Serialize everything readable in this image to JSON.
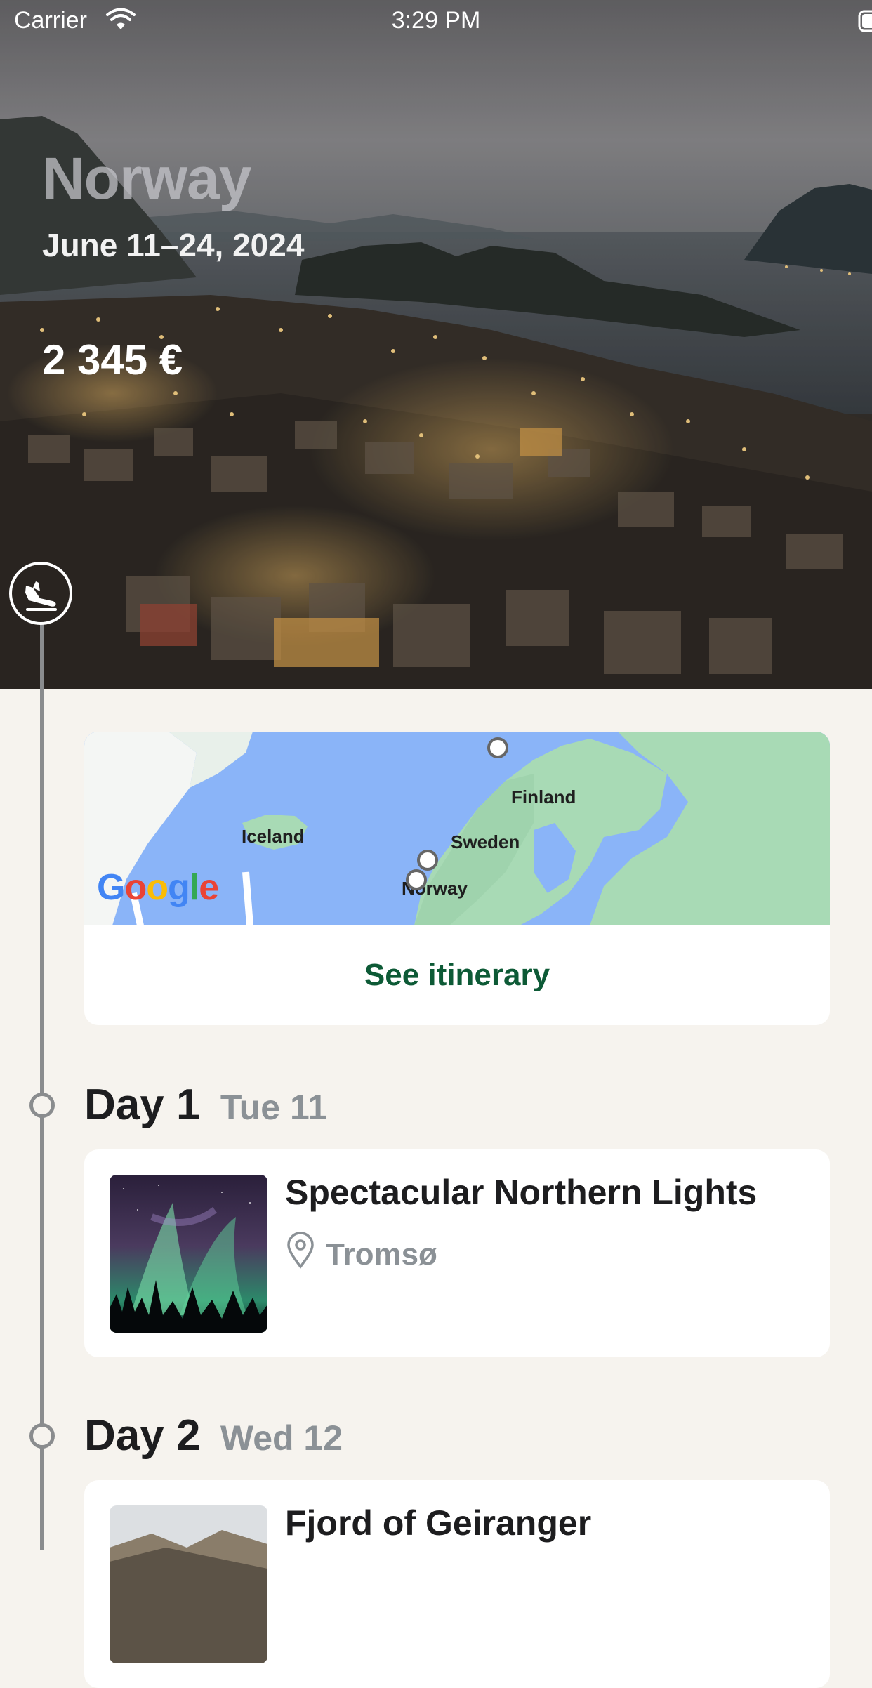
{
  "status_bar": {
    "carrier": "Carrier",
    "time": "3:29 PM"
  },
  "trip": {
    "destination": "Norway",
    "dates": "June 11–24, 2024",
    "price": "2 345 €"
  },
  "map": {
    "labels": [
      "Finland",
      "Iceland",
      "Sweden",
      "Norway"
    ],
    "logo": "Google",
    "see_itinerary_label": "See itinerary"
  },
  "days": [
    {
      "title": "Day 1",
      "date": "Tue 11",
      "activity": {
        "title": "Spectacular Northern Lights",
        "location": "Tromsø"
      }
    },
    {
      "title": "Day 2",
      "date": "Wed 12",
      "activity": {
        "title": "Fjord of Geiranger"
      }
    }
  ],
  "icons": {
    "flight": "airplane-landing-icon",
    "location": "map-pin-icon",
    "wifi": "wifi-icon",
    "battery": "battery-icon"
  },
  "colors": {
    "background": "#f6f3ee",
    "accent": "#0d5a36",
    "muted_text": "#8b9196",
    "timeline": "#8a8c8e"
  }
}
